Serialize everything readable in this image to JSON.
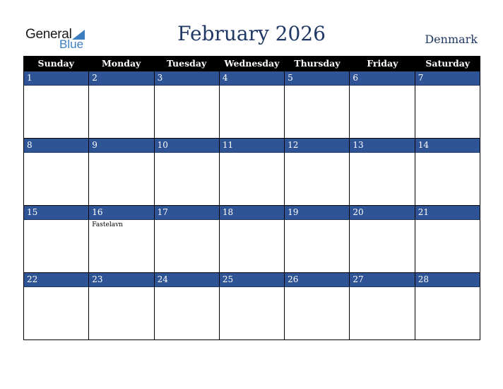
{
  "logo": {
    "general": "General",
    "blue": "Blue"
  },
  "title": "February 2026",
  "country": "Denmark",
  "weekdays": [
    "Sunday",
    "Monday",
    "Tuesday",
    "Wednesday",
    "Thursday",
    "Friday",
    "Saturday"
  ],
  "weeks": [
    [
      {
        "day": "1",
        "event": ""
      },
      {
        "day": "2",
        "event": ""
      },
      {
        "day": "3",
        "event": ""
      },
      {
        "day": "4",
        "event": ""
      },
      {
        "day": "5",
        "event": ""
      },
      {
        "day": "6",
        "event": ""
      },
      {
        "day": "7",
        "event": ""
      }
    ],
    [
      {
        "day": "8",
        "event": ""
      },
      {
        "day": "9",
        "event": ""
      },
      {
        "day": "10",
        "event": ""
      },
      {
        "day": "11",
        "event": ""
      },
      {
        "day": "12",
        "event": ""
      },
      {
        "day": "13",
        "event": ""
      },
      {
        "day": "14",
        "event": ""
      }
    ],
    [
      {
        "day": "15",
        "event": ""
      },
      {
        "day": "16",
        "event": "Fastelavn"
      },
      {
        "day": "17",
        "event": ""
      },
      {
        "day": "18",
        "event": ""
      },
      {
        "day": "19",
        "event": ""
      },
      {
        "day": "20",
        "event": ""
      },
      {
        "day": "21",
        "event": ""
      }
    ],
    [
      {
        "day": "22",
        "event": ""
      },
      {
        "day": "23",
        "event": ""
      },
      {
        "day": "24",
        "event": ""
      },
      {
        "day": "25",
        "event": ""
      },
      {
        "day": "26",
        "event": ""
      },
      {
        "day": "27",
        "event": ""
      },
      {
        "day": "28",
        "event": ""
      }
    ]
  ],
  "colors": {
    "header_bg": "#000000",
    "day_bar": "#2e5496",
    "title": "#1f3864",
    "logo_blue": "#3d7ec0"
  }
}
